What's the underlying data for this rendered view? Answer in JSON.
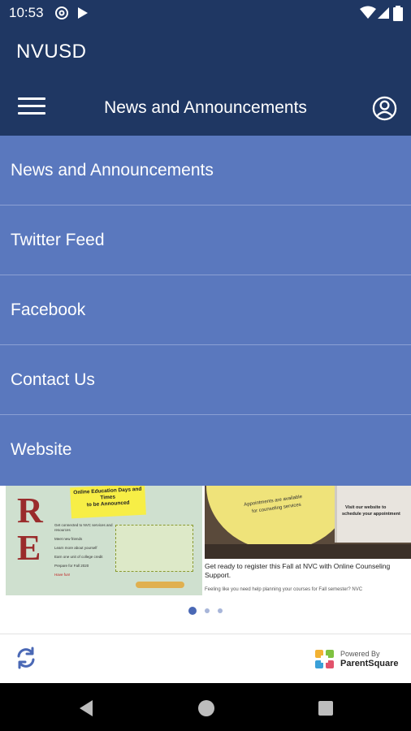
{
  "status_bar": {
    "time": "10:53",
    "icons": [
      "at-sign-icon",
      "play-store-icon",
      "wifi-icon",
      "signal-icon",
      "battery-icon"
    ]
  },
  "app_bar": {
    "app_title": "NVUSD",
    "page_title": "News and Announcements",
    "menu_icon": "hamburger-menu-icon",
    "account_icon": "account-circle-icon"
  },
  "drawer": {
    "items": [
      {
        "label": "News and Announcements"
      },
      {
        "label": "Twitter Feed"
      },
      {
        "label": "Facebook"
      },
      {
        "label": "Contact Us"
      },
      {
        "label": "Website"
      }
    ]
  },
  "carousel": {
    "card1": {
      "big_text": "IRE",
      "note_1": "Online Education Days and Times",
      "note_2": "to be Announced",
      "bullets": [
        "Get connected to NVC services and resources",
        "Meet new friends",
        "Learn more about yourself",
        "Earn one unit of college credit",
        "Prepare for Fall 2020",
        "Have fun!"
      ]
    },
    "card2": {
      "sign_1": "Appointments are available",
      "sign_2": "for counseling services",
      "screen_1": "Visit our website to",
      "screen_2": "schedule your appointment",
      "caption": "Get ready to register this Fall at NVC with Online Counseling Support.",
      "subcaption": "Feeling like you need help planning your courses for Fall semester? NVC"
    },
    "pages": 3,
    "active_page": 0
  },
  "bottom_bar": {
    "refresh_icon": "refresh-icon",
    "powered_by": "Powered By",
    "brand": "ParentSquare"
  },
  "colors": {
    "header": "#1f3763",
    "drawer": "#5a78be",
    "accent": "#4a68b5"
  }
}
